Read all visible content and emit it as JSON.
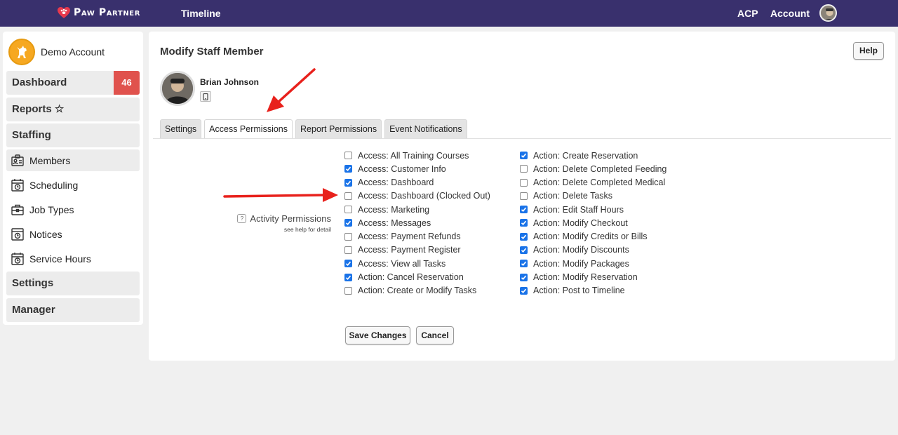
{
  "topbar": {
    "brand": "Paw Partner",
    "nav_timeline": "Timeline",
    "nav_acp": "ACP",
    "nav_account": "Account",
    "bg_color": "#39306d"
  },
  "sidebar": {
    "account_name": "Demo Account",
    "dashboard": {
      "label": "Dashboard",
      "badge": "46"
    },
    "reports": "Reports ☆",
    "staffing": "Staffing",
    "staffing_items": [
      {
        "label": "Members",
        "icon": "id-card-icon"
      },
      {
        "label": "Scheduling",
        "icon": "calendar-clock-icon"
      },
      {
        "label": "Job Types",
        "icon": "briefcase-icon"
      },
      {
        "label": "Notices",
        "icon": "notice-clock-icon"
      },
      {
        "label": "Service Hours",
        "icon": "calendar-clock-icon"
      }
    ],
    "settings": "Settings",
    "manager": "Manager",
    "badge_color": "#e0524d"
  },
  "main": {
    "title": "Modify Staff Member",
    "help_label": "Help",
    "staff_name": "Brian Johnson",
    "tabs": [
      {
        "label": "Settings",
        "active": false
      },
      {
        "label": "Access Permissions",
        "active": true
      },
      {
        "label": "Report Permissions",
        "active": false
      },
      {
        "label": "Event Notifications",
        "active": false
      }
    ],
    "activity_label": "Activity Permissions",
    "activity_help_icon": "?",
    "activity_sub": "see help for detail",
    "permissions_col1": [
      {
        "label": "Access: All Training Courses",
        "checked": false
      },
      {
        "label": "Access: Customer Info",
        "checked": true
      },
      {
        "label": "Access: Dashboard",
        "checked": true
      },
      {
        "label": "Access: Dashboard (Clocked Out)",
        "checked": false
      },
      {
        "label": "Access: Marketing",
        "checked": false
      },
      {
        "label": "Access: Messages",
        "checked": true
      },
      {
        "label": "Access: Payment Refunds",
        "checked": false
      },
      {
        "label": "Access: Payment Register",
        "checked": false
      },
      {
        "label": "Access: View all Tasks",
        "checked": true
      },
      {
        "label": "Action: Cancel Reservation",
        "checked": true
      },
      {
        "label": "Action: Create or Modify Tasks",
        "checked": false
      }
    ],
    "permissions_col2": [
      {
        "label": "Action: Create Reservation",
        "checked": true
      },
      {
        "label": "Action: Delete Completed Feeding",
        "checked": false
      },
      {
        "label": "Action: Delete Completed Medical",
        "checked": false
      },
      {
        "label": "Action: Delete Tasks",
        "checked": false
      },
      {
        "label": "Action: Edit Staff Hours",
        "checked": true
      },
      {
        "label": "Action: Modify Checkout",
        "checked": true
      },
      {
        "label": "Action: Modify Credits or Bills",
        "checked": true
      },
      {
        "label": "Action: Modify Discounts",
        "checked": true
      },
      {
        "label": "Action: Modify Packages",
        "checked": true
      },
      {
        "label": "Action: Modify Reservation",
        "checked": true
      },
      {
        "label": "Action: Post to Timeline",
        "checked": true
      }
    ],
    "save_label": "Save Changes",
    "cancel_label": "Cancel",
    "checkbox_color": "#1a73e8"
  },
  "annotations": {
    "arrow_color": "#e8211c"
  }
}
